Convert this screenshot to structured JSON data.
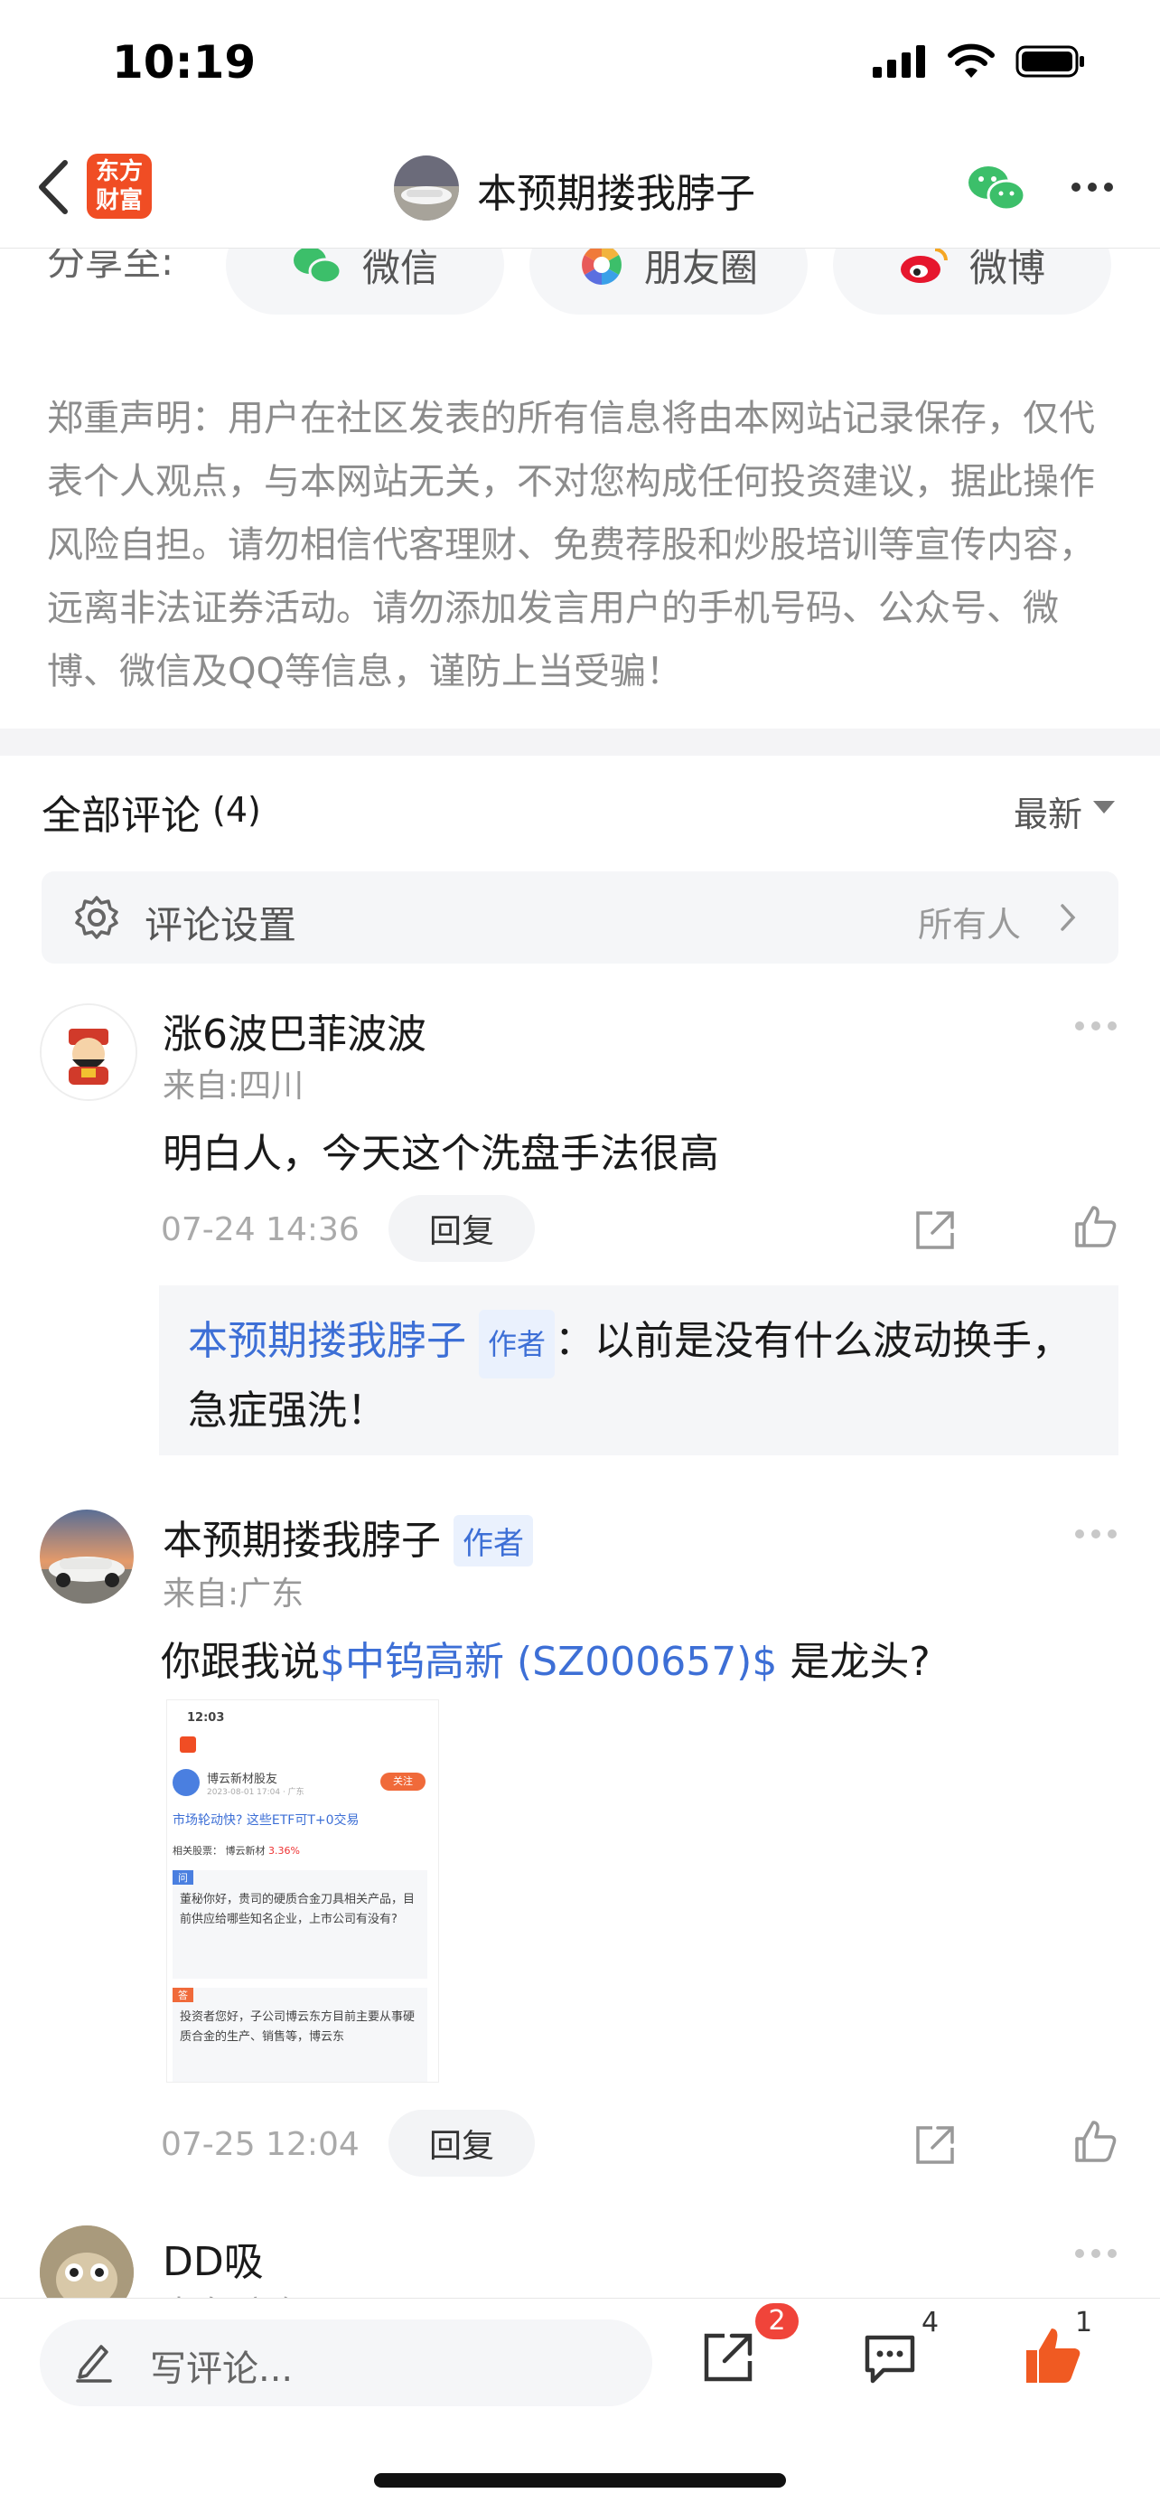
{
  "status_bar": {
    "time": "10:19"
  },
  "nav": {
    "logo_line1": "东方",
    "logo_line2": "财富",
    "title": "本预期搂我脖子"
  },
  "share": {
    "label": "分享至:",
    "options": [
      {
        "label": "微信",
        "icon": "wechat-icon"
      },
      {
        "label": "朋友圈",
        "icon": "moments-icon"
      },
      {
        "label": "微博",
        "icon": "weibo-icon"
      }
    ]
  },
  "disclaimer": "郑重声明：用户在社区发表的所有信息将由本网站记录保存，仅代表个人观点，与本网站无关，不对您构成任何投资建议，据此操作风险自担。请勿相信代客理财、免费荐股和炒股培训等宣传内容，远离非法证券活动。请勿添加发言用户的手机号码、公众号、微博、微信及QQ等信息，谨防上当受骗！",
  "comments_header": {
    "title": "全部评论",
    "count": "(4)",
    "sort": "最新"
  },
  "settings": {
    "label": "评论设置",
    "value": "所有人"
  },
  "comments": [
    {
      "username": "涨6波巴菲波波",
      "from": "来自:四川",
      "content": "明白人，今天这个洗盘手法很高",
      "time": "07-24 14:36",
      "reply_label": "回复",
      "reply": {
        "author": "本预期搂我脖子",
        "author_tag": "作者",
        "separator": "：",
        "text": "以前是没有什么波动换手，急症强洗！"
      }
    },
    {
      "username": "本预期搂我脖子",
      "author_tag": "作者",
      "from": "来自:广东",
      "content_prefix": "你跟我说",
      "content_link": "$中钨高新 (SZ000657)$",
      "content_suffix": " 是龙头?",
      "time": "07-25 12:04",
      "reply_label": "回复",
      "thumbnail": {
        "time": "12:03",
        "poster": "博云新材股友",
        "poster_meta": "2023-08-01 17:04 · 广东",
        "follow": "关注",
        "headline": "市场轮动快? 这些ETF可T+0交易",
        "related_label": "相关股票：",
        "related_stock": "博云新材",
        "related_change": "3.36%",
        "q_tag": "问",
        "question": "董秘你好，贵司的硬质合金刀具相关产品，目前供应给哪些知名企业，上市公司有没有?",
        "a_tag": "答",
        "answer": "投资者您好，子公司博云东方目前主要从事硬质合金的生产、销售等，博云东"
      }
    },
    {
      "username": "DD吸",
      "from": "来自:广东"
    }
  ],
  "bottom_bar": {
    "placeholder": "写评论...",
    "share_badge": "2",
    "comment_count": "4",
    "like_count": "1"
  },
  "colors": {
    "brand": "#f04d24",
    "link": "#3d6fd6",
    "like": "#f05a22",
    "badge": "#f0443a"
  }
}
